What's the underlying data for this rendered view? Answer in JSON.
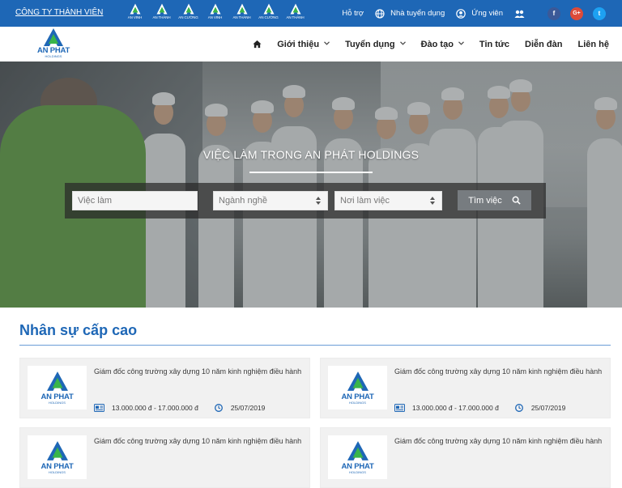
{
  "topbar": {
    "company_link": "CÔNG TY THÀNH VIÊN",
    "member_logos": [
      {
        "label": "AN VINH",
        "icon": "an-phat-mark-icon"
      },
      {
        "label": "AN THÀNH",
        "icon": "an-phat-mark-icon"
      },
      {
        "label": "AN CƯỜNG",
        "icon": "an-phat-mark-icon"
      },
      {
        "label": "AN VINH",
        "icon": "an-phat-mark-icon"
      },
      {
        "label": "AN THÀNH",
        "icon": "an-phat-mark-icon"
      },
      {
        "label": "AN CƯỜNG",
        "icon": "an-phat-mark-icon"
      },
      {
        "label": "AN THÀNH",
        "icon": "an-phat-mark-icon"
      }
    ],
    "support": "Hỗ trợ",
    "recruiter": "Nhà tuyển dụng",
    "candidate": "Ứng viên",
    "social": [
      "f",
      "G+",
      "t"
    ],
    "colors": {
      "bar": "#1e67b6",
      "facebook": "#3b5998",
      "google": "#dd4b39",
      "twitter": "#1da1f2"
    }
  },
  "brand": {
    "name": "AN PHAT",
    "sub": "HOLDINGS",
    "colors": {
      "blue": "#1e67b6",
      "green": "#3ab54a"
    }
  },
  "nav": {
    "home_icon": "home-icon",
    "items": [
      {
        "label": "Giới thiệu",
        "dropdown": true
      },
      {
        "label": "Tuyển dụng",
        "dropdown": true
      },
      {
        "label": "Đào tạo",
        "dropdown": true
      },
      {
        "label": "Tin tức",
        "dropdown": false
      },
      {
        "label": "Diễn đàn",
        "dropdown": false
      },
      {
        "label": "Liên hệ",
        "dropdown": false
      }
    ]
  },
  "hero": {
    "title": "VIỆC LÀM TRONG AN PHÁT HOLDINGS",
    "search": {
      "keyword_placeholder": "Việc làm",
      "industry_placeholder": "Ngành nghề",
      "location_placeholder": "Nơi làm việc",
      "button_label": "Tìm việc"
    }
  },
  "section": {
    "title": "Nhân sự cấp cao",
    "jobs": [
      {
        "title": "Giám đốc công trường xây dựng 10 năm kinh nghiệm điều hành",
        "salary": "13.000.000 đ - 17.000.000 đ",
        "date": "25/07/2019",
        "company": "AN PHAT",
        "company_sub": "HOLDINGS"
      },
      {
        "title": "Giám đốc công trường xây dựng 10 năm kinh nghiệm điều hành",
        "salary": "13.000.000 đ - 17.000.000 đ",
        "date": "25/07/2019",
        "company": "AN PHAT",
        "company_sub": "HOLDINGS"
      },
      {
        "title": "Giám đốc công trường xây dựng 10 năm kinh nghiệm điều hành",
        "salary": "",
        "date": "",
        "company": "AN PHAT",
        "company_sub": "HOLDINGS"
      },
      {
        "title": "Giám đốc công trường xây dựng 10 năm kinh nghiệm điều hành",
        "salary": "",
        "date": "",
        "company": "AN PHAT",
        "company_sub": "HOLDINGS"
      }
    ]
  }
}
